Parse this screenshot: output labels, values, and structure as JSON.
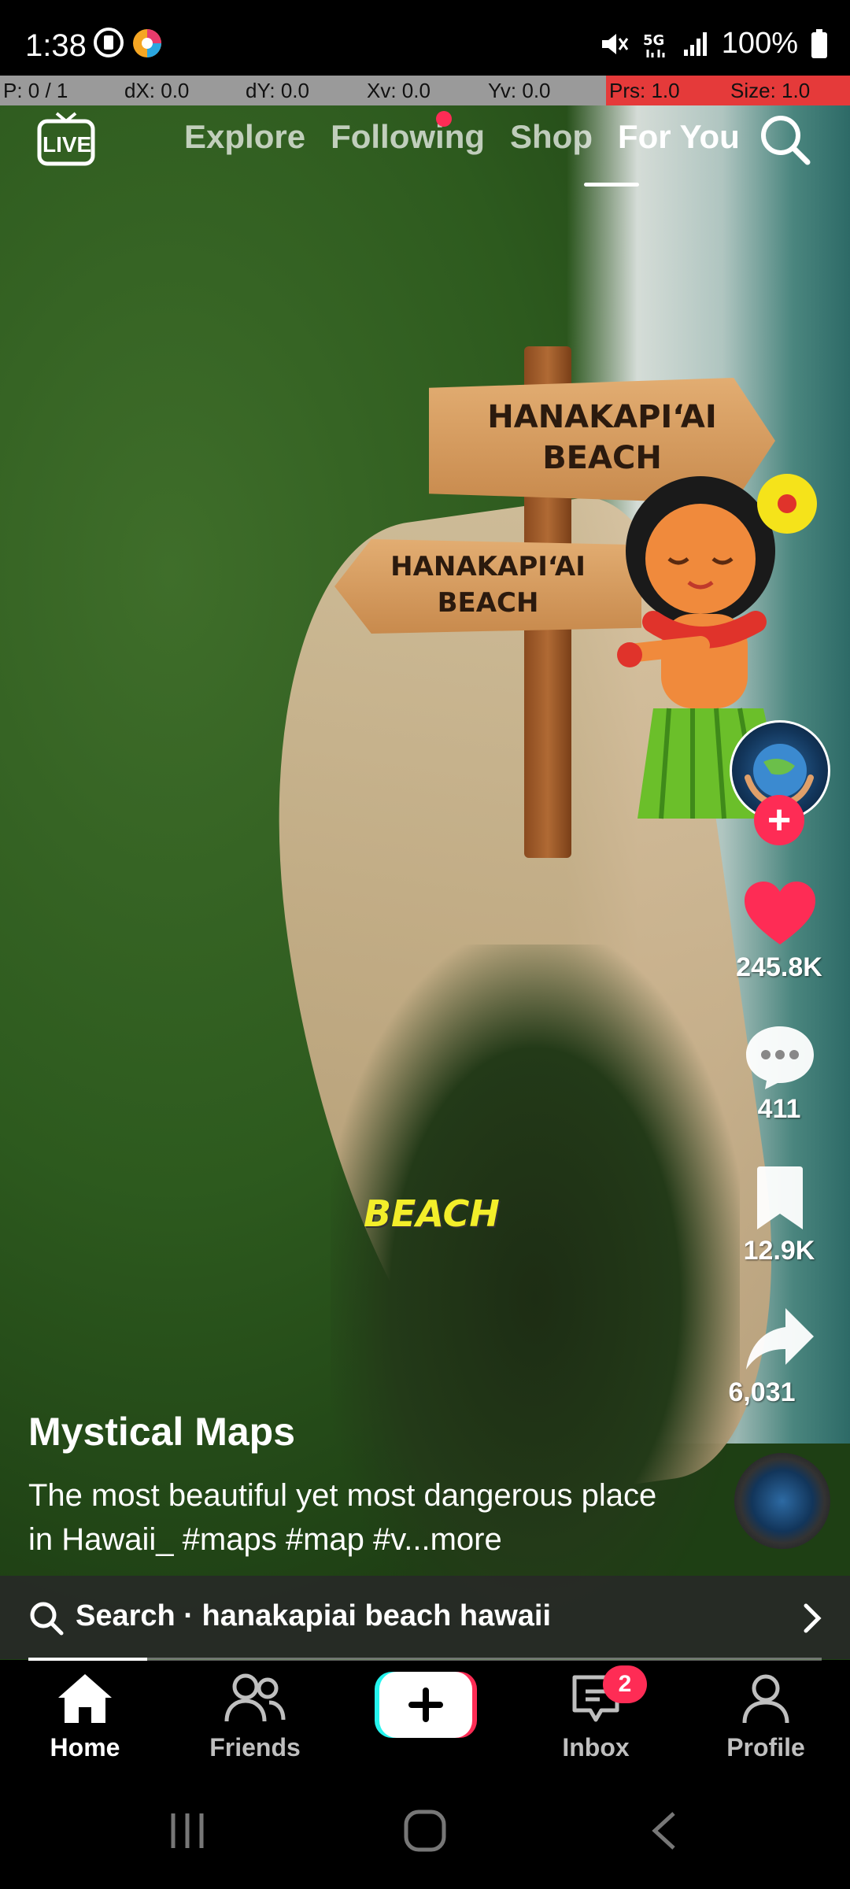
{
  "status_bar": {
    "time": "1:38",
    "battery": "100%"
  },
  "debug_overlay": {
    "fields": [
      "P: 0 / 1",
      "dX: 0.0",
      "dY: 0.0",
      "Xv: 0.0",
      "Yv: 0.0",
      "Prs: 1.0",
      "Size: 1.0"
    ]
  },
  "top_nav": {
    "live_label": "LIVE",
    "tabs": [
      "Explore",
      "Following",
      "Shop",
      "For You"
    ],
    "active_tab": "For You"
  },
  "video": {
    "sign_text_1": "HANAKAPI‘AI\nBEACH",
    "sign_text_2": "HANAKAPI‘AI\nBEACH",
    "overlay_text": "BEACH"
  },
  "actions": {
    "likes": "245.8K",
    "comments": "411",
    "saves": "12.9K",
    "shares": "6,031"
  },
  "post": {
    "author": "Mystical Maps",
    "caption": "The most beautiful yet most dangerous place in Hawaii_ #maps #map #v...more"
  },
  "search_suggestion": {
    "text": "Search · hanakapiai beach hawaii"
  },
  "playback": {
    "progress": 0.15
  },
  "bottom_nav": {
    "home": "Home",
    "friends": "Friends",
    "inbox": "Inbox",
    "inbox_badge": "2",
    "profile": "Profile"
  },
  "colors": {
    "accent": "#fe2c55",
    "create_cyan": "#25f4ee"
  }
}
